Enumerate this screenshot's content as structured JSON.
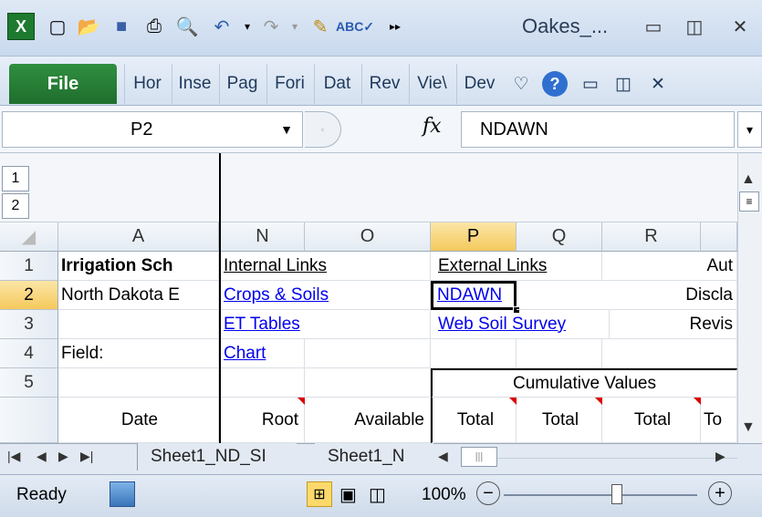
{
  "title": "Oakes_...",
  "quick_access": [
    "excel-logo-icon",
    "new-icon",
    "open-icon",
    "save-icon",
    "print-icon",
    "print-preview-icon",
    "undo-icon",
    "redo-icon",
    "format-painter-icon",
    "spelling-icon",
    "more-icon"
  ],
  "ribbon": {
    "file": "File",
    "tabs": [
      "Hor",
      "Inse",
      "Pag",
      "Fori",
      "Dat",
      "Rev",
      "Vie\\",
      "Dev"
    ]
  },
  "namebox": "P2",
  "formula": "NDAWN",
  "fx": "fx",
  "outline": [
    "1",
    "2"
  ],
  "columns": [
    "A",
    "N",
    "O",
    "P",
    "Q",
    "R"
  ],
  "rows": [
    "1",
    "2",
    "3",
    "4",
    "5",
    ""
  ],
  "cells": {
    "a1": "Irrigation Sch",
    "a2": "North Dakota E",
    "a4": "Field:",
    "a6": "Date",
    "n1": "Internal Links",
    "n2": "Crops & Soils",
    "n3": "ET Tables",
    "n4": "Chart",
    "n6": "Root",
    "o6": "Available",
    "p1": "External Links",
    "p2": "NDAWN",
    "p3": "Web Soil Survey",
    "p5": "Cumulative Values",
    "p6": "Total",
    "q6": "Total",
    "r6": "Total",
    "s1": "Aut",
    "s2": "Discla",
    "s3": "Revis",
    "s6": "To"
  },
  "sheets": [
    "Sheet1_ND_SI",
    "Sheet1_N"
  ],
  "status": {
    "ready": "Ready",
    "zoom": "100%"
  }
}
